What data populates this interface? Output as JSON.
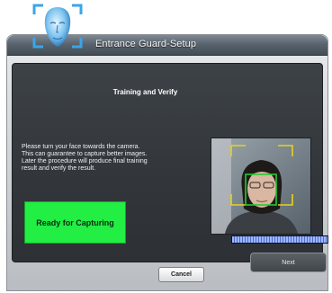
{
  "logo": {
    "icon": "face-scan-icon"
  },
  "window": {
    "title": "Entrance Guard-Setup"
  },
  "panel": {
    "title": "Training and Verify",
    "instructions": [
      "Please turn your face towards the camera.",
      "This can guarantee to capture better images.",
      "Later the procedure will produce final training",
      "result and verify the result."
    ],
    "status": "Ready for Capturing",
    "status_color": "#22ee44"
  },
  "camera": {
    "detection_box_color": "#22cc33",
    "frame_color": "#e8d21a"
  },
  "progress": {
    "value": 1.0,
    "color": "#9fb6ff"
  },
  "buttons": {
    "next": "Next",
    "cancel": "Cancel"
  }
}
